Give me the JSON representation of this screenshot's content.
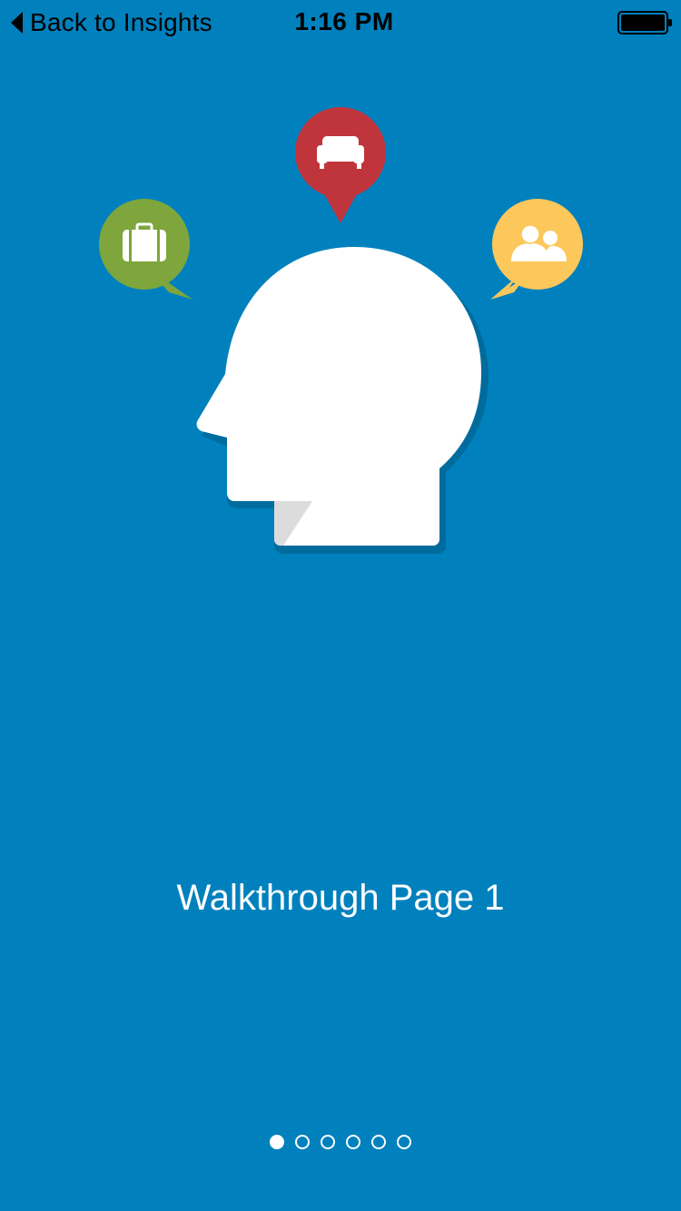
{
  "status_bar": {
    "back_label": "Back to Insights",
    "time": "1:16 PM",
    "battery_level": 1.0
  },
  "illustration": {
    "bubbles": [
      {
        "icon": "briefcase-icon",
        "color": "#7ea63c"
      },
      {
        "icon": "sofa-icon",
        "color": "#c0343c"
      },
      {
        "icon": "people-icon",
        "color": "#fcc75b"
      }
    ],
    "head_color": "#ffffff",
    "head_shadow_color": "#006c9e"
  },
  "main": {
    "title": "Walkthrough Page 1"
  },
  "pager": {
    "current_page": 1,
    "page_count": 6
  },
  "colors": {
    "background": "#0081bd",
    "text": "#ffffff"
  }
}
